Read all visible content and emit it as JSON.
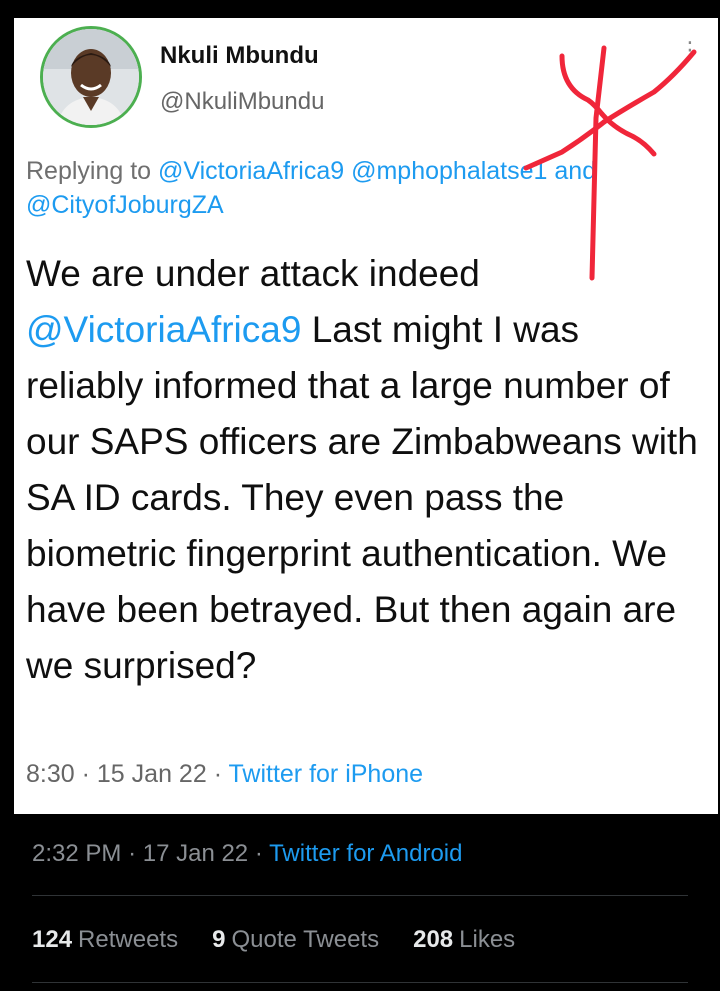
{
  "tweet_card": {
    "display_name": "Nkuli Mbundu",
    "handle": "@NkuliMbundu",
    "replying_prefix": "Replying to",
    "replying_mentions": [
      "@VictoriaAfrica9",
      "@mphophalatse1",
      "and"
    ],
    "replying_mention_2": "@CityofJoburgZA",
    "text_line_1": "We are under attack indeed",
    "text_mention": "@VictoriaAfrica9",
    "text_line_2_rest": " Last might I was",
    "text_rest": "reliably informed that a large number of our SAPS officers are Zimbabweans with SA ID cards. They even pass the biometric fingerprint authentication. We have been betrayed. But then again are we surprised?",
    "time": "8:30",
    "date": "15 Jan 22",
    "source": "Twitter for iPhone",
    "more_icon": "more-icon"
  },
  "annotation": {
    "color": "#f0263a",
    "shape": "asterisk-scribble"
  },
  "outer_tweet": {
    "time": "2:32 PM",
    "date": "17 Jan 22",
    "source": "Twitter for Android",
    "stats": [
      {
        "count": "124",
        "label": "Retweets"
      },
      {
        "count": "9",
        "label": "Quote Tweets"
      },
      {
        "count": "208",
        "label": "Likes"
      }
    ]
  },
  "colors": {
    "link": "#1d9bf0",
    "background": "#000000",
    "card": "#ffffff"
  }
}
